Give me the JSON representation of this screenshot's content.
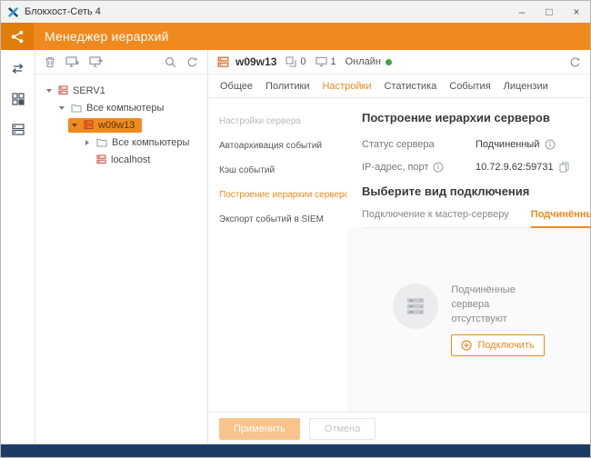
{
  "window": {
    "title": "Блокхост-Сеть 4",
    "minimize_glyph": "–",
    "maximize_glyph": "□",
    "close_glyph": "×"
  },
  "header": {
    "title": "Менеджер иерархий"
  },
  "tree": {
    "items": [
      {
        "label": "SERV1"
      },
      {
        "label": "Все компьютеры"
      },
      {
        "label": "w09w13"
      },
      {
        "label": "Все компьютеры"
      },
      {
        "label": "localhost"
      }
    ]
  },
  "main": {
    "server": {
      "name": "w09w13",
      "policies_count": "0",
      "computers_count": "1",
      "status": "Онлайн"
    },
    "tabs": [
      {
        "label": "Общее"
      },
      {
        "label": "Политики"
      },
      {
        "label": "Настройки"
      },
      {
        "label": "Статистика"
      },
      {
        "label": "События"
      },
      {
        "label": "Лицензии"
      }
    ],
    "settings_nav": [
      {
        "label": "Настройки сервера"
      },
      {
        "label": "Автоархивация событий"
      },
      {
        "label": "Кэш событий"
      },
      {
        "label": "Построение иерархии серверов"
      },
      {
        "label": "Экспорт событий в SIEM"
      }
    ],
    "content": {
      "title": "Построение иерархии серверов",
      "fields": [
        {
          "label": "Статус сервера",
          "value": "Подчиненный"
        },
        {
          "label": "IP-адрес, порт",
          "value": "10.72.9.62:59731"
        }
      ],
      "subtitle": "Выберите вид подключения",
      "conn_tabs": [
        {
          "label": "Подключение к мастер-серверу"
        },
        {
          "label": "Подчинённые серверы"
        }
      ],
      "empty_state": {
        "message": "Подчинённые сервера отсутствуют",
        "connect_button": "Подключить"
      }
    },
    "footer": {
      "apply_label": "Применить",
      "cancel_label": "Отмена"
    }
  },
  "colors": {
    "accent": "#f0891e",
    "online_green": "#43a047",
    "taskbar_navy": "#1d3c63"
  }
}
